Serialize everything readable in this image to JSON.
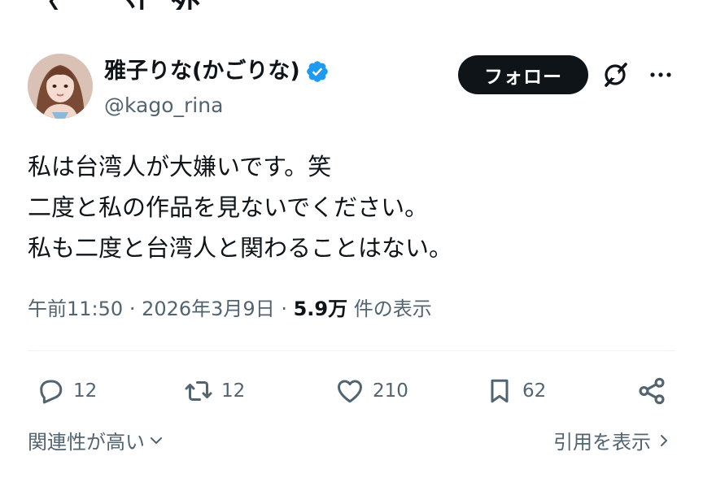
{
  "author": {
    "display_name": "雅子りな(かごりな)",
    "handle": "@kago_rina"
  },
  "follow_label": "フォロー",
  "post_lines": [
    "私は台湾人が大嫌いです。笑",
    "二度と私の作品を見ないでください。",
    "私も二度と台湾人と関わることはない。"
  ],
  "meta": {
    "time": "午前11:50",
    "date": "2026年3月9日",
    "views_count": "5.9万",
    "views_label": "件の表示"
  },
  "actions": {
    "replies": "12",
    "reposts": "12",
    "likes": "210",
    "bookmarks": "62"
  },
  "footer": {
    "sort_label": "関連性が高い",
    "quotes_label": "引用を表示"
  },
  "colors": {
    "text": "#0f1419",
    "secondary": "#536471",
    "verified": "#1d9bf0",
    "follow_bg": "#0f1419"
  },
  "icons": [
    "verified-badge-icon",
    "grok-icon",
    "more-icon",
    "reply-icon",
    "repost-icon",
    "like-icon",
    "bookmark-icon",
    "share-icon",
    "chevron-down-icon",
    "chevron-right-icon"
  ]
}
